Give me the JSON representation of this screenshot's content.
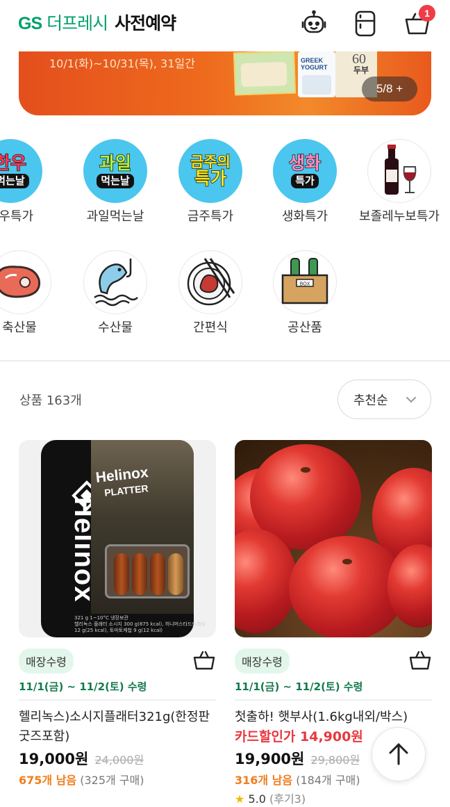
{
  "header": {
    "brand_gs": "GS",
    "brand_fresh": "더프레시",
    "brand_title": "사전예약",
    "cart_badge": "1",
    "icons": [
      "robot-icon",
      "fridge-icon",
      "cart-icon"
    ]
  },
  "banner": {
    "date_range": "10/1(화)~10/31(목), 31일간",
    "product_greek": "GREEK\nYOGURT",
    "product_60": "60",
    "product_tofu": "두부",
    "pager": "5/8 +"
  },
  "categories": [
    {
      "label": "한우특가",
      "top": "한우",
      "bottom": "먹는날",
      "style": "bubble"
    },
    {
      "label": "과일먹는날",
      "top": "과일",
      "bottom": "먹는날",
      "style": "bubble"
    },
    {
      "label": "금주특가",
      "top": "금주의",
      "bottom": "특가",
      "style": "bubble"
    },
    {
      "label": "생화특가",
      "top": "생화",
      "bottom": "특가",
      "style": "bubble"
    },
    {
      "label": "보졸레누보특가",
      "icon": "wine-icon"
    },
    {
      "label": "축산물",
      "icon": "meat-icon"
    },
    {
      "label": "수산물",
      "icon": "fish-icon"
    },
    {
      "label": "간편식",
      "icon": "meal-icon"
    },
    {
      "label": "공산품",
      "icon": "box-icon"
    }
  ],
  "listing": {
    "count_label": "상품 163개",
    "sort_label": "추천순"
  },
  "products": [
    {
      "tag": "매장수령",
      "pickup_date": "11/1(금) ~ 11/2(토) 수령",
      "name": "헬리녹스)소시지플래터321g(한정판굿즈포함)",
      "price": "19,000원",
      "old_price": "24,000원",
      "stock_left": "675개 남음",
      "purchased": "(325개 구매)",
      "image_brand": "Helinox",
      "image_title": "Helinox",
      "image_subtitle": "PLATTER",
      "image_net": "321 g",
      "image_storage": "1~10°C 냉장보관",
      "image_ingredients": "헬리녹스 플래터 소시지 300 g(875 kcal), 허니머스타드드레싱 12 g(25 kcal), 토마토케첩 9 g(12 kcal)"
    },
    {
      "tag": "매장수령",
      "pickup_date": "11/1(금) ~ 11/2(토) 수령",
      "name": "첫출하! 햇부사(1.6kg내외/박스)",
      "promo": "카드할인가 14,900원",
      "price": "19,900원",
      "old_price": "29,800원",
      "stock_left": "316개 남음",
      "purchased": "(184개 구매)",
      "rating": "5.0",
      "reviews": "(후기3)"
    }
  ],
  "colors": {
    "brand_green": "#00a06a",
    "badge_red": "#f03c46",
    "promo_red": "#e8373f",
    "stock_orange": "#f07d1c",
    "date_green": "#137a4c",
    "tag_bg": "#e3f6ec",
    "category_blue": "#4bc6ee"
  }
}
